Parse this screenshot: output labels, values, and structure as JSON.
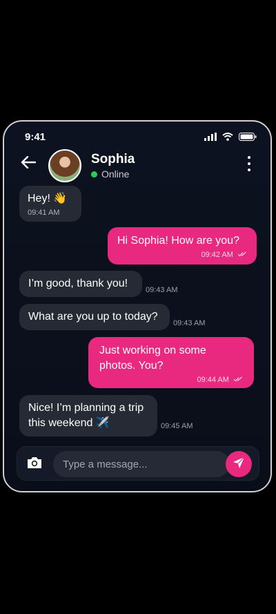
{
  "status_bar": {
    "time": "9:41",
    "icons": [
      "signal-icon",
      "wifi-icon",
      "battery-icon"
    ]
  },
  "header": {
    "contact_name": "Sophia",
    "contact_status": "Online",
    "status_color": "#2ecc57",
    "icons": [
      "back-arrow-icon",
      "more-vert-icon"
    ]
  },
  "messages": [
    {
      "direction": "incoming",
      "text": "Hey! 👋",
      "time": "09:41 AM"
    },
    {
      "direction": "outgoing",
      "text": "Hi Sophia! How are you?",
      "time": "09:42 AM"
    },
    {
      "direction": "incoming",
      "text": "I’m good, thank you!",
      "time": "09:43 AM"
    },
    {
      "direction": "incoming",
      "text": "What are you up to today?",
      "time": "09:43 AM"
    },
    {
      "direction": "outgoing",
      "text": "Just working on some photos. You?",
      "time": "09:44 AM"
    },
    {
      "direction": "incoming",
      "text": "Nice! I’m planning a trip this weekend ✈️",
      "time": "09:45 AM"
    }
  ],
  "composer": {
    "placeholder": "Type a message...",
    "icons": [
      "camera-icon",
      "send-icon"
    ]
  },
  "colors": {
    "accent": "#e9287f",
    "incoming_bubble": "#252a35",
    "background": "#0b0f1b"
  }
}
